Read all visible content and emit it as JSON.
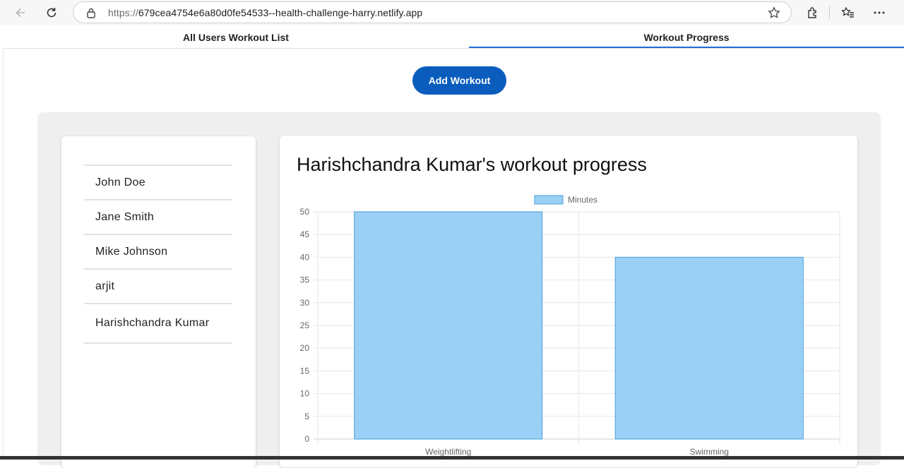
{
  "browser": {
    "url_scheme": "https://",
    "url_host": "679cea4754e6a80d0fe54533--health-challenge-harry.netlify.app",
    "icons": [
      "back-icon",
      "refresh-icon",
      "lock-icon",
      "star-icon",
      "extensions-icon",
      "favorites-icon",
      "more-icon"
    ]
  },
  "tabs": [
    {
      "label": "All Users Workout List"
    },
    {
      "label": "Workout Progress"
    }
  ],
  "add_button": {
    "label": "Add Workout"
  },
  "users": [
    {
      "name": "John Doe"
    },
    {
      "name": "Jane Smith"
    },
    {
      "name": "Mike Johnson"
    },
    {
      "name": "arjit"
    },
    {
      "name": "Harishchandra Kumar"
    }
  ],
  "chart_title": "Harishchandra Kumar's workout progress",
  "chart_data": {
    "type": "bar",
    "categories": [
      "Weightlifting",
      "Swimming"
    ],
    "series": [
      {
        "name": "Minutes",
        "values": [
          50,
          40
        ],
        "color": "#9ad0f5",
        "border": "#4a9fd8"
      }
    ],
    "ylim": [
      0,
      50
    ],
    "yticks": [
      0,
      5,
      10,
      15,
      20,
      25,
      30,
      35,
      40,
      45,
      50
    ],
    "legend": "top",
    "grid": true
  },
  "colors": {
    "accent": "#0a5dbd",
    "tab_indicator": "#1f6fd1",
    "panel": "#efefef"
  }
}
